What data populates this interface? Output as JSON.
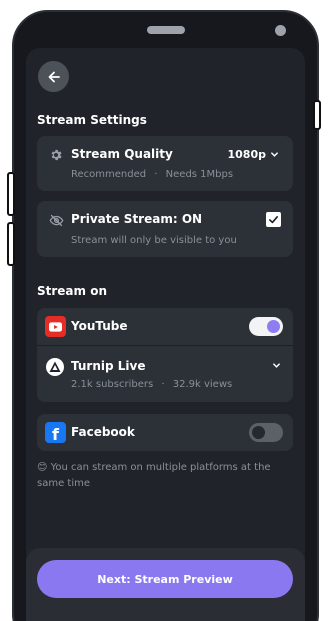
{
  "header": {
    "back_icon": "arrow-left-icon"
  },
  "stream_settings": {
    "title": "Stream Settings",
    "quality": {
      "label": "Stream Quality",
      "value": "1080p",
      "recommended": "Recommended",
      "separator": "·",
      "bandwidth": "Needs 1Mbps"
    },
    "private": {
      "label": "Private Stream: ON",
      "description": "Stream will only be visible to you",
      "checked": true
    }
  },
  "stream_on": {
    "title": "Stream on",
    "youtube": {
      "label": "YouTube",
      "enabled": true,
      "channel": {
        "name": "Turnip Live",
        "subscribers": "2.1k subscribers",
        "separator": "·",
        "views": "32.9k views"
      }
    },
    "facebook": {
      "label": "Facebook",
      "enabled": false
    }
  },
  "info": {
    "emoji": "😊",
    "text": "You can stream on multiple platforms at the same time"
  },
  "footer": {
    "next_label": "Next: Stream Preview"
  },
  "colors": {
    "accent": "#8a78f0",
    "youtube": "#e52d27",
    "facebook": "#1877f2",
    "background": "#20242a",
    "card": "#2c3037"
  }
}
